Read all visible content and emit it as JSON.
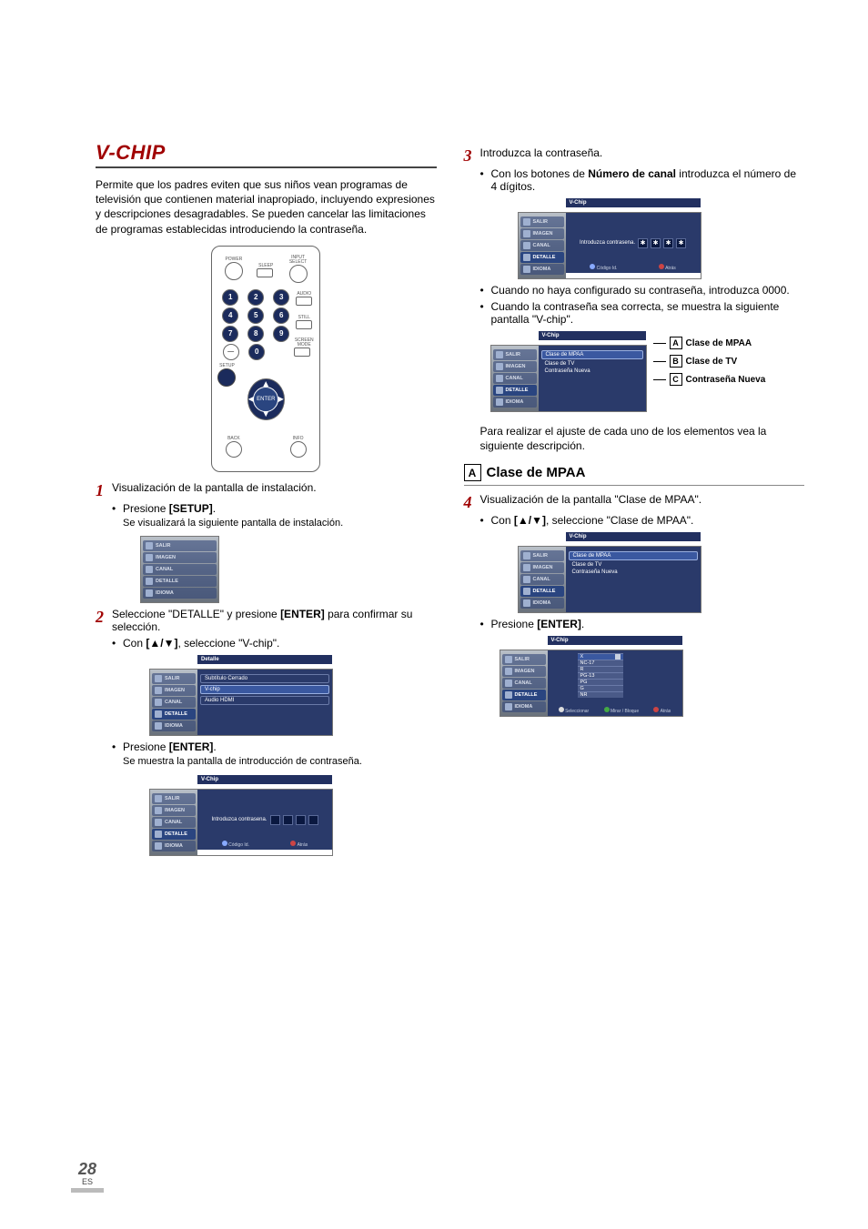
{
  "title": "V-CHIP",
  "intro": "Permite que los padres eviten que sus niños vean programas de televisión que contienen material inapropiado, incluyendo expresiones y descripciones desagradables. Se pueden cancelar las limitaciones de programas establecidas introduciendo la contraseña.",
  "remote": {
    "top_labels": {
      "power": "POWER",
      "sleep": "SLEEP",
      "input": "INPUT SELECT"
    },
    "digits": [
      "1",
      "2",
      "3",
      "4",
      "5",
      "6",
      "7",
      "8",
      "9",
      "0"
    ],
    "side_top": "AUDIO",
    "side_mid": "STILL",
    "side_low": "SCREEN MODE",
    "dash": "—",
    "setup": "SETUP",
    "enter": "ENTER",
    "back": "BACK",
    "info": "INFO"
  },
  "osd_tabs": [
    "SALIR",
    "IMAGEN",
    "CANAL",
    "DETALLE",
    "IDIOMA"
  ],
  "step1": {
    "text": "Visualización de la pantalla de instalación.",
    "b1": "Presione ",
    "b1_key": "[SETUP]",
    "b1_tail": ".",
    "sub": "Se visualizará la siguiente pantalla de instalación."
  },
  "step2": {
    "text_a": "Seleccione \"DETALLE\" y presione ",
    "text_key": "[ENTER]",
    "text_b": " para confirmar su selección.",
    "b1": "Con ",
    "b1_keys": "[▲/▼]",
    "b1_tail": ", seleccione \"V-chip\".",
    "osd_title": "Detalle",
    "osd_opts": [
      "Subtítulo Cerrado",
      "V-chip",
      "Audio HDMI"
    ],
    "b2": "Presione ",
    "b2_key": "[ENTER]",
    "b2_tail": ".",
    "sub": "Se muestra la pantalla de introducción de contraseña.",
    "pw_title": "V-Chip",
    "pw_prompt": "Introduzca contrasena.",
    "pw_footer_a": "Código Id.",
    "pw_footer_b": "Atrás"
  },
  "step3": {
    "text": "Introduzca la contraseña.",
    "b1_a": "Con los botones de ",
    "b1_key": "Número de canal",
    "b1_b": " introduzca el número de 4 dígitos.",
    "pw_title": "V-Chip",
    "pw_prompt": "Introduzca contrasena.",
    "pw_star": "✱",
    "pw_footer_a": "Código Id.",
    "pw_footer_b": "Atrás",
    "b2": "Cuando no haya configurado su contraseña, introduzca 0000.",
    "b3": "Cuando la contraseña sea correcta, se muestra la siguiente pantalla \"V-chip\".",
    "menu_title": "V-Chip",
    "menu_opts": [
      "Clase de MPAA",
      "Clase de TV",
      "Contraseña Nueva"
    ],
    "annot": {
      "A": "Clase de MPAA",
      "B": "Clase de TV",
      "C": "Contraseña Nueva"
    },
    "tail": "Para realizar el ajuste de cada uno de los elementos vea la siguiente descripción."
  },
  "sectionA": {
    "letter": "A",
    "heading": "Clase de MPAA"
  },
  "step4": {
    "text": "Visualización de la pantalla \"Clase de MPAA\".",
    "b1": "Con ",
    "b1_keys": "[▲/▼]",
    "b1_tail": ", seleccione \"Clase de MPAA\".",
    "menu_title": "V-Chip",
    "menu_opts": [
      "Clase de MPAA",
      "Clase de TV",
      "Contraseña Nueva"
    ],
    "b2": "Presione ",
    "b2_key": "[ENTER]",
    "b2_tail": ".",
    "ratings_title": "V-Chip",
    "ratings": [
      "X",
      "NC-17",
      "R",
      "PG-13",
      "PG",
      "G",
      "NR"
    ],
    "footer_a": "Seleccionar",
    "footer_b": "Mirar / Bloque",
    "footer_c": "Atrás"
  },
  "page": {
    "num": "28",
    "lang": "ES"
  }
}
